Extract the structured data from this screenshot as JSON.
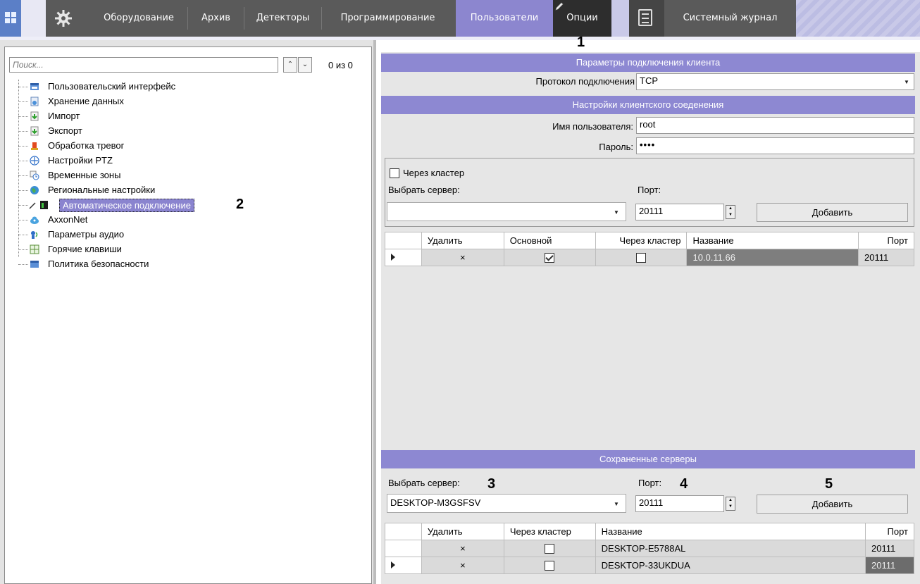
{
  "nav": {
    "items": [
      {
        "label": "Оборудование"
      },
      {
        "label": "Архив"
      },
      {
        "label": "Детекторы"
      },
      {
        "label": "Программирование"
      },
      {
        "label": "Пользователи"
      },
      {
        "label": "Опции"
      },
      {
        "label": "Системный журнал"
      }
    ],
    "active": "Опции",
    "icons": [
      "apps-grid-icon",
      "gear-icon",
      "pencil-icon",
      "journal-icon"
    ]
  },
  "callouts": [
    "1",
    "2",
    "3",
    "4",
    "5"
  ],
  "left": {
    "search_placeholder": "Поиск...",
    "match_count": "0 из 0",
    "tree": [
      {
        "label": "Пользовательский интерфейс",
        "icon": "window-icon"
      },
      {
        "label": "Хранение данных",
        "icon": "storage-icon"
      },
      {
        "label": "Импорт",
        "icon": "import-icon"
      },
      {
        "label": "Экспорт",
        "icon": "export-icon"
      },
      {
        "label": "Обработка тревог",
        "icon": "alarm-icon"
      },
      {
        "label": "Настройки PTZ",
        "icon": "ptz-icon"
      },
      {
        "label": "Временные зоны",
        "icon": "time-zones-icon"
      },
      {
        "label": "Региональные настройки",
        "icon": "globe-icon"
      },
      {
        "label": "Автоматическое подключение",
        "icon": "auto-connect-icon",
        "selected": true
      },
      {
        "label": "AxxonNet",
        "icon": "cloud-icon"
      },
      {
        "label": "Параметры аудио",
        "icon": "audio-icon"
      },
      {
        "label": "Горячие клавиши",
        "icon": "hotkeys-icon"
      },
      {
        "label": "Политика безопасности",
        "icon": "security-icon"
      }
    ]
  },
  "right": {
    "connection_header": "Параметры подключения клиента",
    "protocol_label": "Протокол подключения",
    "protocol_value": "TCP",
    "client_header": "Настройки клиентского соеденения",
    "username_label": "Имя пользователя:",
    "username_value": "root",
    "password_label": "Пароль:",
    "password_value": "••••",
    "via_cluster_label": "Через кластер",
    "select_server_label": "Выбрать сервер:",
    "port_label": "Порт:",
    "port_value": "20111",
    "add_button": "Добавить",
    "table1": {
      "headers": [
        "Удалить",
        "Основной",
        "Через кластер",
        "Название",
        "Порт"
      ],
      "rows": [
        {
          "delete": "×",
          "primary": true,
          "via_cluster": false,
          "name": "10.0.11.66",
          "port": "20111"
        }
      ]
    },
    "saved_header": "Сохраненные серверы",
    "saved_server_value": "DESKTOP-M3GSFSV",
    "saved_port_value": "20111",
    "table2": {
      "headers": [
        "Удалить",
        "Через кластер",
        "Название",
        "Порт"
      ],
      "rows": [
        {
          "delete": "×",
          "via_cluster": false,
          "name": "DESKTOP-E5788AL",
          "port": "20111"
        },
        {
          "delete": "×",
          "via_cluster": false,
          "name": "DESKTOP-33UKDUA",
          "port": "20111"
        }
      ]
    }
  }
}
